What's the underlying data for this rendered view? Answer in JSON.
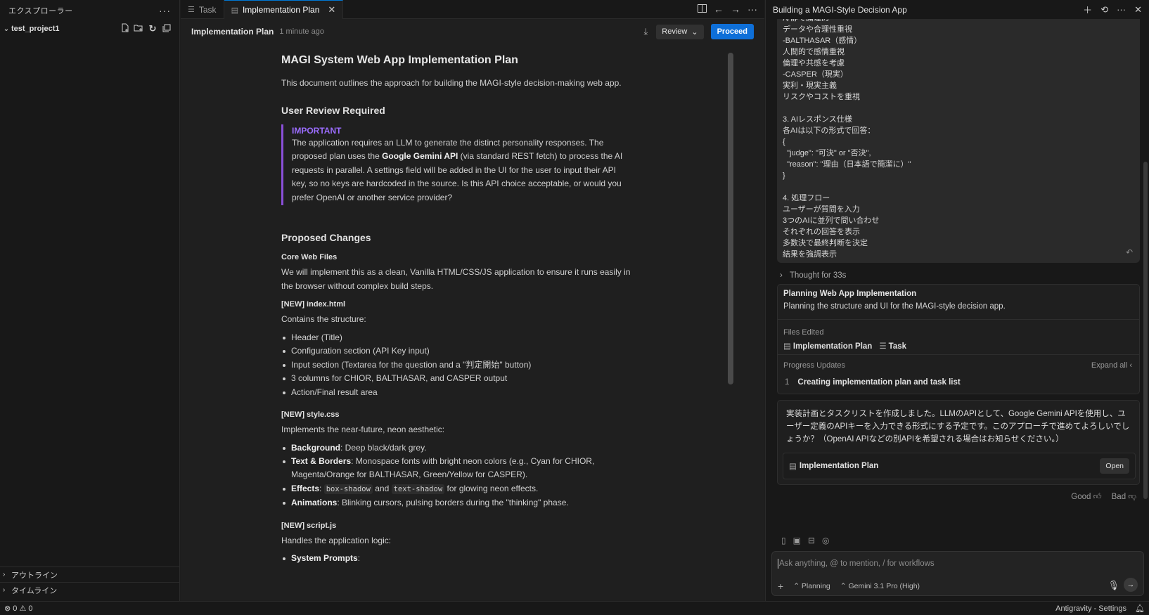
{
  "sidebar": {
    "title": "エクスプローラー",
    "more": "···",
    "project": "test_project1",
    "outline": "アウトライン",
    "timeline": "タイムライン"
  },
  "tabs": [
    {
      "label": "Task"
    },
    {
      "label": "Implementation Plan"
    }
  ],
  "doc_header": {
    "title": "Implementation Plan",
    "time": "1 minute ago",
    "review": "Review",
    "proceed": "Proceed"
  },
  "doc": {
    "h1": "MAGI System Web App Implementation Plan",
    "intro": "This document outlines the approach for building the MAGI-style decision-making web app.",
    "review_heading": "User Review Required",
    "alert_title": "IMPORTANT",
    "alert_pre": "The application requires an LLM to generate the distinct personality responses. The proposed plan uses the ",
    "alert_bold": "Google Gemini API",
    "alert_post": " (via standard REST fetch) to process the AI requests in parallel. A settings field will be added in the UI for the user to input their API key, so no keys are hardcoded in the source. Is this API choice acceptable, or would you prefer OpenAI or another service provider?",
    "changes_heading": "Proposed Changes",
    "core_heading": "Core Web Files",
    "core_text": "We will implement this as a clean, Vanilla HTML/CSS/JS application to ensure it runs easily in the browser without complex build steps.",
    "index_heading": "[NEW] index.html",
    "index_text": "Contains the structure:",
    "index_items": [
      "Header (Title)",
      "Configuration section (API Key input)",
      "Input section (Textarea for the question and a \"判定開始\" button)",
      "3 columns for CHIOR, BALTHASAR, and CASPER output",
      "Action/Final result area"
    ],
    "style_heading": "[NEW] style.css",
    "style_text": "Implements the near-future, neon aesthetic:",
    "style_items": [
      {
        "bold": "Background",
        "text": ": Deep black/dark grey."
      },
      {
        "bold": "Text & Borders",
        "text": ": Monospace fonts with bright neon colors (e.g., Cyan for CHIOR, Magenta/Orange for BALTHASAR, Green/Yellow for CASPER)."
      },
      {
        "bold": "Effects",
        "code1": "box-shadow",
        "mid": " and ",
        "code2": "text-shadow",
        "text": " for glowing neon effects."
      },
      {
        "bold": "Animations",
        "text": ": Blinking cursors, pulsing borders during the \"thinking\" phase."
      }
    ],
    "script_heading": "[NEW] script.js",
    "script_text": "Handles the application logic:",
    "script_items": [
      {
        "bold": "System Prompts",
        "text": ":"
      }
    ]
  },
  "panel": {
    "title": "Building a MAGI-Style Decision App",
    "user_lines": [
      "冷静で論理的",
      "データや合理性重視",
      "-BALTHASAR（感情）",
      "人間的で感情重視",
      "倫理や共感を考慮",
      "-CASPER（現実）",
      "実利・現実主義",
      "リスクやコストを重視",
      "",
      "3. AIレスポンス仕様",
      "各AIは以下の形式で回答：",
      "{",
      "  \"judge\": \"可決\" or \"否決\",",
      "  \"reason\": \"理由（日本語で簡潔に）\"",
      "}",
      "",
      "4. 処理フロー",
      "ユーザーが質問を入力",
      "3つのAIに並列で問い合わせ",
      "それぞれの回答を表示",
      "多数決で最終判断を決定",
      "結果を強調表示"
    ],
    "thought": "Thought for 33s",
    "task_title": "Planning Web App Implementation",
    "task_sub": "Planning the structure and UI for the MAGI-style decision app.",
    "files_edited_label": "Files Edited",
    "files_edited": [
      "Implementation Plan",
      "Task"
    ],
    "progress_label": "Progress Updates",
    "expand_all": "Expand all",
    "progress_items": [
      {
        "num": "1",
        "text": "Creating implementation plan and task list"
      }
    ],
    "reply": "実装計画とタスクリストを作成しました。LLMのAPIとして、Google Gemini APIを使用し、ユーザー定義のAPIキーを入力できる形式にする予定です。このアプローチで進めてよろしいでしょうか？（OpenAI APIなどの別APIを希望される場合はお知らせください。）",
    "plan_link": "Implementation Plan",
    "open": "Open",
    "good": "Good",
    "bad": "Bad",
    "composer_placeholder": "Ask anything, @ to mention, / for workflows",
    "mode": "Planning",
    "model": "Gemini 3.1 Pro (High)"
  },
  "status": {
    "errors": "0",
    "warnings": "0",
    "right": "Antigravity - Settings"
  }
}
